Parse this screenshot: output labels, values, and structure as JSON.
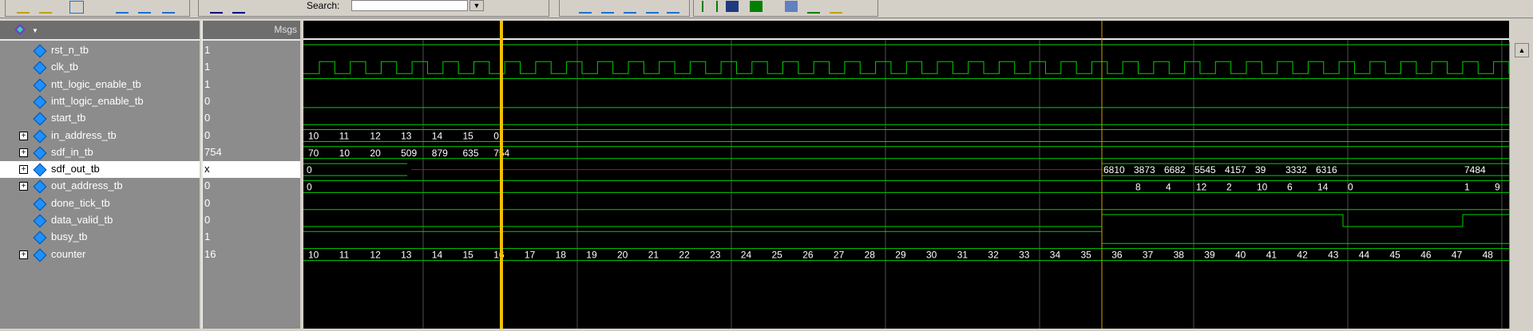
{
  "toolbar": {
    "search_label": "Search:",
    "search_value": ""
  },
  "panes": {
    "names_header_icon": "wave-icon",
    "values_header": "Msgs"
  },
  "signals": [
    {
      "name": "rst_n_tb",
      "value": "1",
      "expandable": false
    },
    {
      "name": "clk_tb",
      "value": "1",
      "expandable": false
    },
    {
      "name": "ntt_logic_enable_tb",
      "value": "1",
      "expandable": false
    },
    {
      "name": "intt_logic_enable_tb",
      "value": "0",
      "expandable": false
    },
    {
      "name": "start_tb",
      "value": "0",
      "expandable": false
    },
    {
      "name": "in_address_tb",
      "value": "0",
      "expandable": true
    },
    {
      "name": "sdf_in_tb",
      "value": "754",
      "expandable": true
    },
    {
      "name": "sdf_out_tb",
      "value": "x",
      "expandable": true,
      "selected": true
    },
    {
      "name": "out_address_tb",
      "value": "0",
      "expandable": true
    },
    {
      "name": "done_tick_tb",
      "value": "0",
      "expandable": false
    },
    {
      "name": "data_valid_tb",
      "value": "0",
      "expandable": false
    },
    {
      "name": "busy_tb",
      "value": "1",
      "expandable": false
    },
    {
      "name": "counter",
      "value": "16",
      "expandable": true
    }
  ],
  "waves": {
    "colors": {
      "signal": "#00d000",
      "undefined": "#e00000",
      "cursor_main": "#f0c000",
      "cursor_2": "#d0a000",
      "grid": "#505050"
    },
    "in_address_labels": [
      "10",
      "11",
      "12",
      "13",
      "14",
      "15",
      "0"
    ],
    "sdf_in_labels": [
      "70",
      "10",
      "20",
      "509",
      "879",
      "635",
      "754"
    ],
    "sdf_out_first": "0",
    "sdf_out_labels": [
      "6810",
      "3873",
      "6682",
      "5545",
      "4157",
      "39",
      "3332",
      "6316",
      "7484"
    ],
    "out_address_first": "0",
    "out_address_labels": [
      "8",
      "4",
      "12",
      "2",
      "10",
      "6",
      "14",
      "0",
      "1",
      "9"
    ],
    "counter_labels": [
      "10",
      "11",
      "12",
      "13",
      "14",
      "15",
      "16",
      "17",
      "18",
      "19",
      "20",
      "21",
      "22",
      "23",
      "24",
      "25",
      "26",
      "27",
      "28",
      "29",
      "30",
      "31",
      "32",
      "33",
      "34",
      "35",
      "36",
      "37",
      "38",
      "39",
      "40",
      "41",
      "42",
      "43",
      "44",
      "45",
      "46",
      "47",
      "48"
    ]
  }
}
